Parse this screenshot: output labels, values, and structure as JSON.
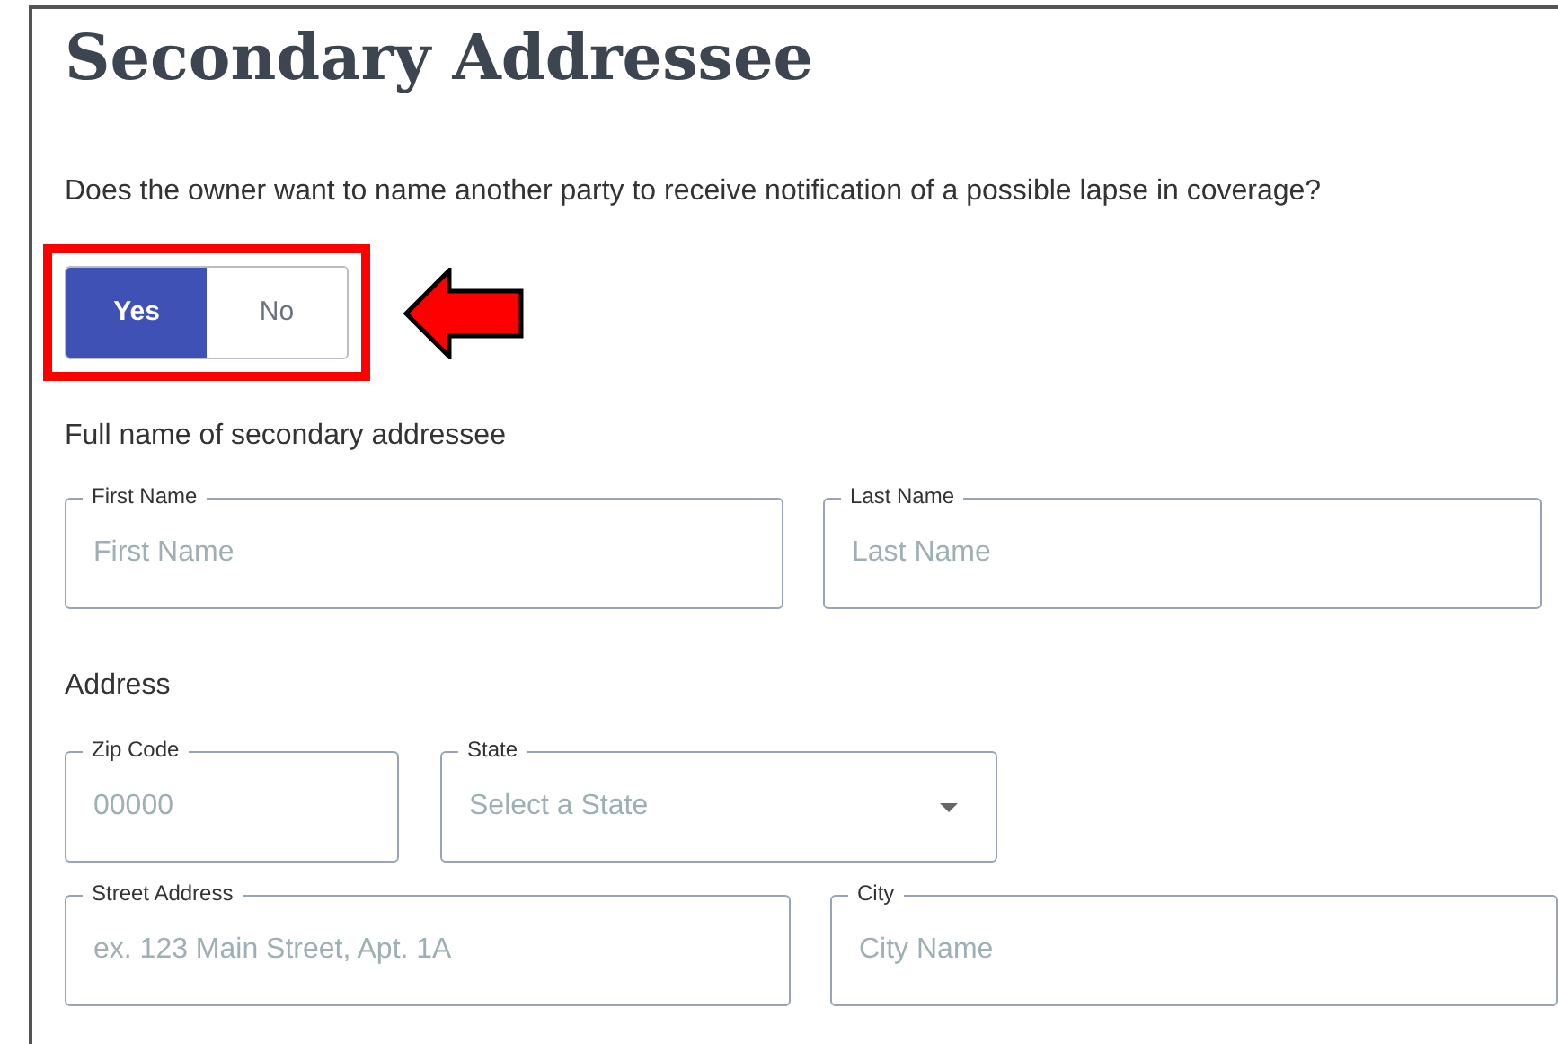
{
  "title": "Secondary Addressee",
  "question": "Does the owner want to name another party to receive notification of a possible lapse in coverage?",
  "toggle": [
    {
      "label": "Yes",
      "selected": true
    },
    {
      "label": "No",
      "selected": false
    }
  ],
  "name_section": {
    "heading": "Full name of secondary addressee",
    "fields": [
      {
        "label": "First Name",
        "placeholder": "First Name",
        "kind": "text"
      },
      {
        "label": "Last Name",
        "placeholder": "Last Name",
        "kind": "text"
      }
    ]
  },
  "address_section": {
    "heading": "Address",
    "rows": [
      [
        {
          "label": "Zip Code",
          "placeholder": "00000",
          "kind": "text"
        },
        {
          "label": "State",
          "placeholder": "Select a State",
          "kind": "select"
        }
      ],
      [
        {
          "label": "Street Address",
          "placeholder": "ex. 123 Main Street, Apt. 1A",
          "kind": "text"
        },
        {
          "label": "City",
          "placeholder": "City Name",
          "kind": "text"
        }
      ]
    ]
  }
}
